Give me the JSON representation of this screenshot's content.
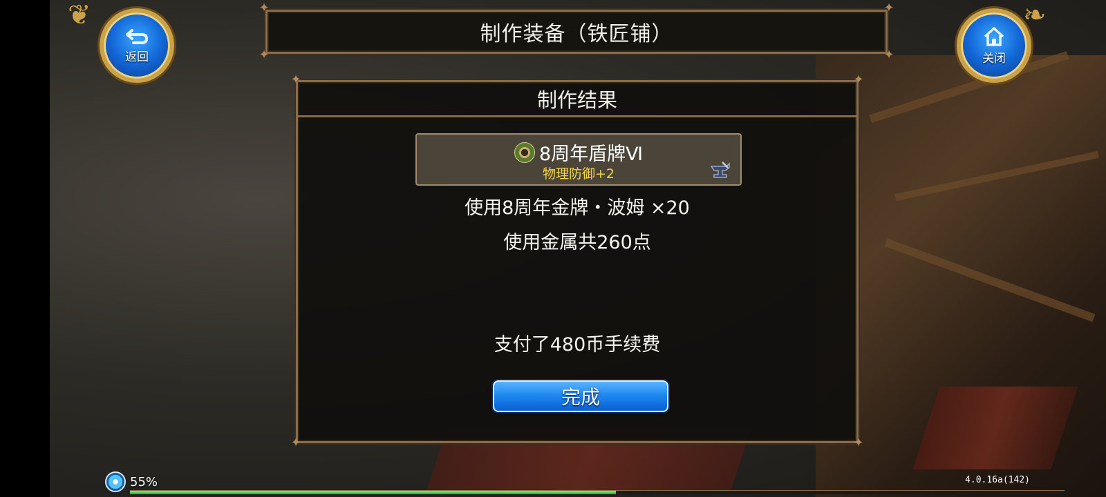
{
  "header": {
    "title": "制作装备（铁匠铺）",
    "back_label": "返回",
    "close_label": "关闭"
  },
  "result": {
    "title": "制作结果",
    "item": {
      "name": "8周年盾牌Ⅵ",
      "stat": "物理防御+2",
      "icon": "shield-icon"
    },
    "material_line": "使用8周年金牌・波姆 ×20",
    "metal_line": "使用金属共260点",
    "fee_line": "支付了480币手续费",
    "done_label": "完成"
  },
  "status": {
    "percent_text": "55%",
    "progress_fraction": 0.52,
    "version": "4.0.16a(142)"
  },
  "colors": {
    "frame": "#8a6b4a",
    "stat_yellow": "#f3d34a",
    "button_blue": "#1c86f0",
    "progress_green": "#22aa33"
  }
}
